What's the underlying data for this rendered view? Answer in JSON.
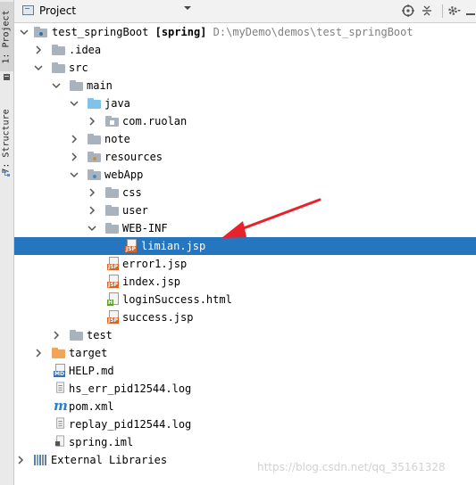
{
  "side_strip": {
    "project_tab": "1: Project",
    "structure_tab": "7: Structure"
  },
  "header": {
    "title": "Project",
    "view_dropdown_icon": "chevron-down-icon",
    "buttons": [
      "target-icon",
      "collapse-all-icon",
      "gear-icon",
      "hide-icon"
    ]
  },
  "tree": {
    "root": {
      "name": "test_springBoot",
      "module": "[spring]",
      "path": "D:\\myDemo\\demos\\test_springBoot"
    },
    "idea": ".idea",
    "src": "src",
    "main": "main",
    "java": "java",
    "package": "com.ruolan",
    "note": "note",
    "resources": "resources",
    "webapp": "webApp",
    "css": "css",
    "user": "user",
    "webinf": "WEB-INF",
    "limian_jsp": "limian.jsp",
    "error1_jsp": "error1.jsp",
    "index_jsp": "index.jsp",
    "loginsuccess_html": "loginSuccess.html",
    "success_jsp": "success.jsp",
    "test": "test",
    "target": "target",
    "help_md": "HELP.md",
    "hs_err_log": "hs_err_pid12544.log",
    "pom_xml": "pom.xml",
    "replay_log": "replay_pid12544.log",
    "spring_iml": "spring.iml",
    "external_libraries": "External Libraries"
  },
  "file_badges": {
    "jsp": "JSP",
    "html": "H",
    "md": "MD"
  },
  "colors": {
    "selection": "#2675bf",
    "annotation_arrow": "#e8212b",
    "folder_orange": "#f0a55a",
    "folder_blue": "#7fc4e8"
  },
  "watermark": "https://blog.csdn.net/qq_35161328"
}
